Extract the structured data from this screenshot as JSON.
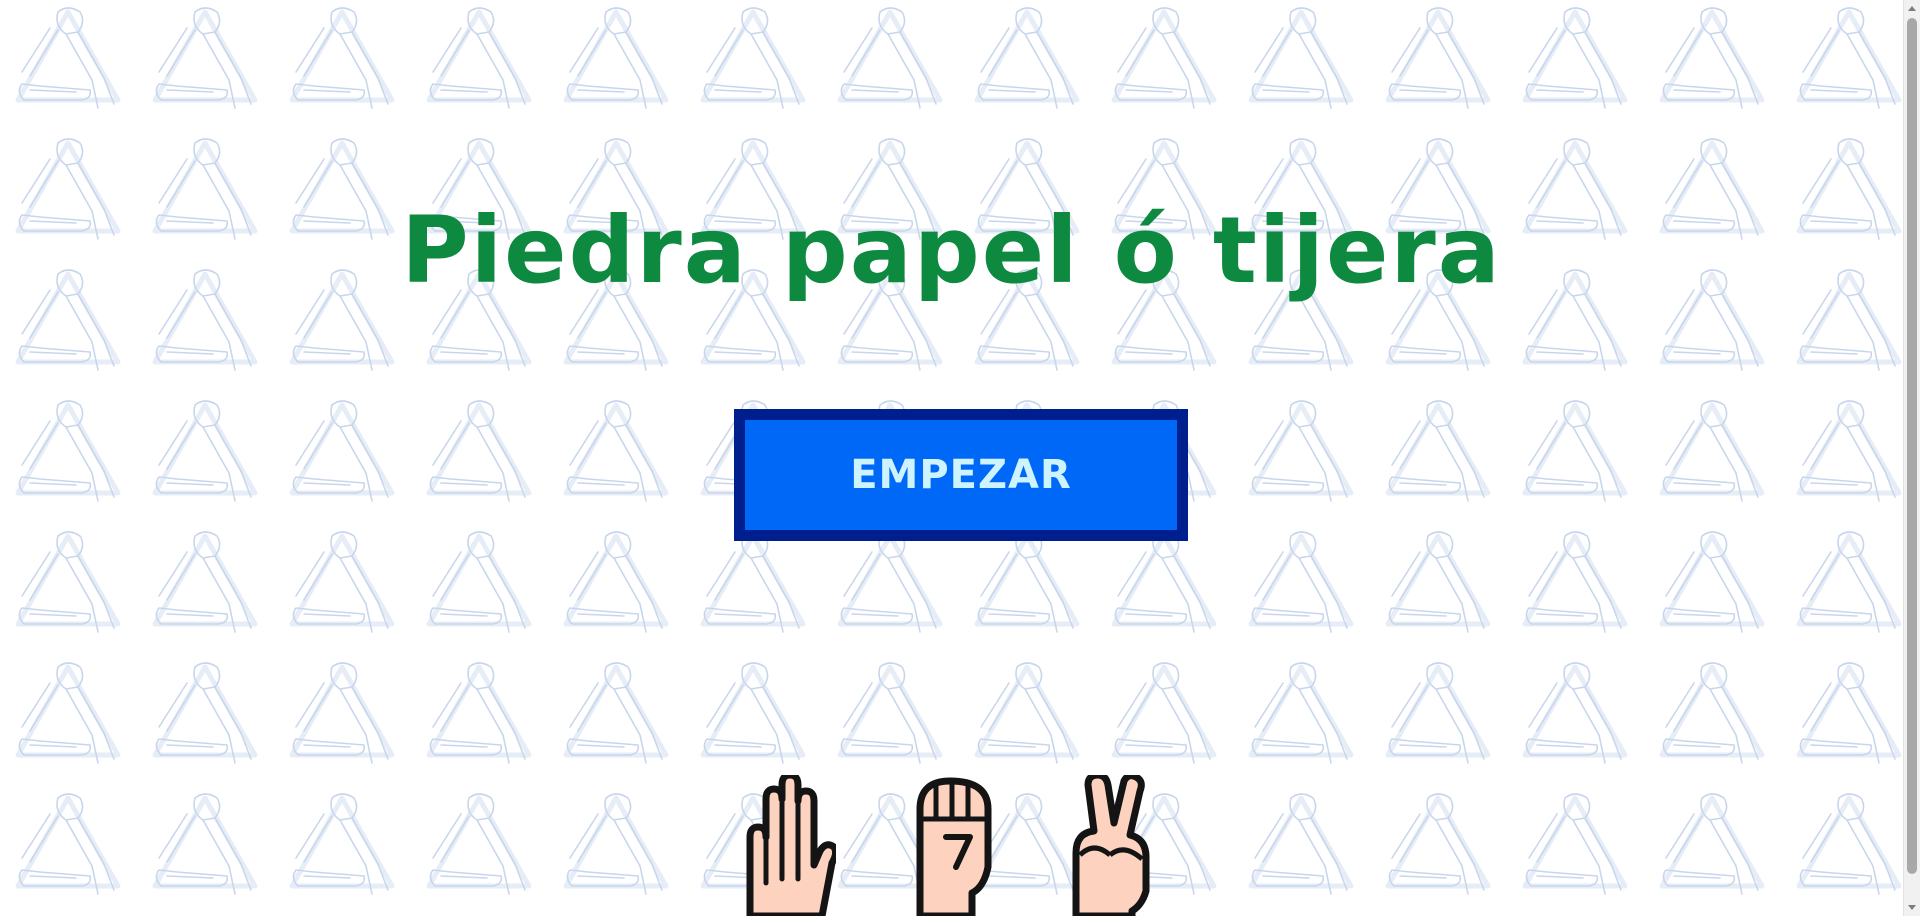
{
  "title": "Piedra papel ó tijera",
  "start_button": {
    "label": "EMPEZAR"
  },
  "hands": [
    {
      "icon": "paper-hand-icon"
    },
    {
      "icon": "rock-fist-icon"
    },
    {
      "icon": "scissors-hand-icon"
    }
  ],
  "background": {
    "icon": "rock-paper-scissors-pattern-icon"
  },
  "colors": {
    "title": "#0d8a3f",
    "button_fill": "#0068f7",
    "button_border": "#001f8f",
    "button_text": "#cdf3ff",
    "skin": "#fdd3bf",
    "outline": "#141414",
    "pattern": "#c8d6ec"
  }
}
